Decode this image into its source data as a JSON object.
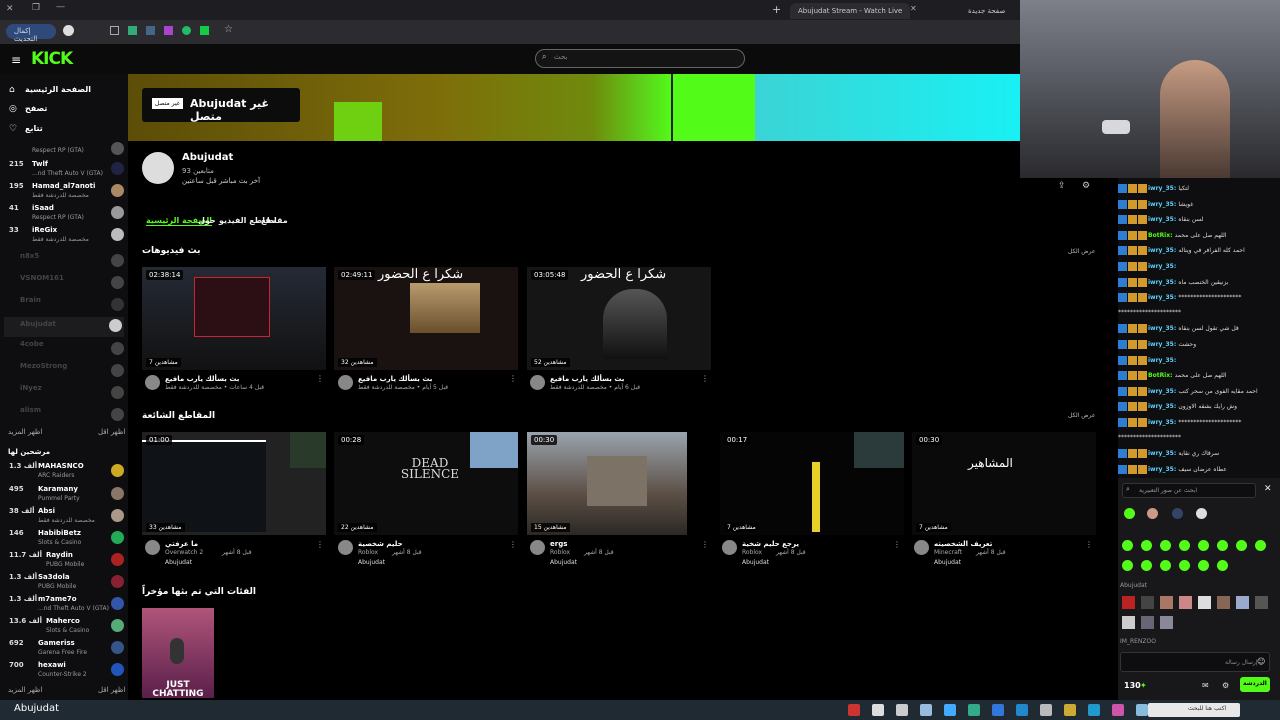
{
  "browser": {
    "tab_left_title": "صفحة جديدة",
    "tab_active_title": "Abujudat Stream - Watch Live",
    "update_button": "إكمال التحديث",
    "new_tab_plus": "+"
  },
  "site": {
    "logo": "KICK",
    "search_placeholder": "بحث"
  },
  "sidebar": {
    "nav": [
      {
        "label": "الصفحة الرئيسية",
        "icon": "home-icon"
      },
      {
        "label": "تصفح",
        "icon": "compass-icon"
      },
      {
        "label": "تتابع",
        "icon": "heart-icon"
      }
    ],
    "following": [
      {
        "count": "",
        "name": "",
        "sub": "Respect RP (GTA)"
      },
      {
        "count": "215",
        "name": "Twlf",
        "sub": "...nd Theft Auto V (GTA)"
      },
      {
        "count": "195",
        "name": "Hamad_al7anoti",
        "sub": "مخصصة للدردشة فقط"
      },
      {
        "count": "41",
        "name": "iSaad",
        "sub": "Respect RP (GTA)"
      },
      {
        "count": "33",
        "name": "iReGix",
        "sub": "مخصصة للدردشة فقط"
      },
      {
        "count": "",
        "name": "n8x5",
        "sub": ""
      },
      {
        "count": "",
        "name": "VSNOM161",
        "sub": ""
      },
      {
        "count": "",
        "name": "Brain",
        "sub": ""
      },
      {
        "count": "",
        "name": "Abujudat",
        "sub": ""
      },
      {
        "count": "",
        "name": "4cobe",
        "sub": ""
      },
      {
        "count": "",
        "name": "MezoStrong",
        "sub": ""
      },
      {
        "count": "",
        "name": "iNyez",
        "sub": ""
      },
      {
        "count": "",
        "name": "alism",
        "sub": ""
      }
    ],
    "show_more_1": "اظهر المزيد",
    "show_less_1": "اظهر اقل",
    "recommended_header": "مرشحين لها",
    "recommended": [
      {
        "count": "1.3 ألف",
        "name": "MAHASNCO",
        "sub": "ARC Raiders"
      },
      {
        "count": "495",
        "name": "Karamany",
        "sub": "Pummel Party"
      },
      {
        "count": "38 ألف",
        "name": "Absi",
        "sub": "مخصصة للدردشة فقط"
      },
      {
        "count": "146",
        "name": "HabibiBetz",
        "sub": "Slots & Casino"
      },
      {
        "count": "11.7 ألف",
        "name": "Raydin",
        "sub": "PUBG Mobile"
      },
      {
        "count": "1.3 ألف",
        "name": "Sa3dola",
        "sub": "PUBG Mobile"
      },
      {
        "count": "1.3 ألف",
        "name": "m7ame7o",
        "sub": "...nd Theft Auto V (GTA)"
      },
      {
        "count": "13.6 ألف",
        "name": "Maherco",
        "sub": "Slots & Casino"
      },
      {
        "count": "692",
        "name": "Gameriss",
        "sub": "Garena Free Fire"
      },
      {
        "count": "700",
        "name": "hexawi",
        "sub": "Counter-Strike 2"
      }
    ],
    "show_more_2": "اظهر المزيد",
    "show_less_2": "اظهر اقل"
  },
  "channel": {
    "offline_title": "Abujudat غير متصل",
    "offline_badge": "غير متصل",
    "name": "Abujudat",
    "followers": "93 متابعين",
    "last_live": "آخر بث مباشر قبل ساعتين",
    "tabs": [
      "الصفحة الرئيسية",
      "حول",
      "مقاطع الفيديو",
      "مقاطع"
    ]
  },
  "videos_section": {
    "title": "بث فيديوهات",
    "show_all": "عرض الكل",
    "items": [
      {
        "duration": "02:38:14",
        "views": "7 مشاهدين",
        "title": "بث بسألك يارب مافيع",
        "sub": "قبل 4 ساعات • مخصصة للدردشة فقط"
      },
      {
        "duration": "02:49:11",
        "views": "32 مشاهدين",
        "title": "بث بسألك يارب مافيع",
        "sub": "قبل 5 أيام • مخصصة للدردشة فقط",
        "overlay": "شكرا ع الحضور"
      },
      {
        "duration": "03:05:48",
        "views": "52 مشاهدين",
        "title": "بث بسألك يارب مافيع",
        "sub": "قبل 6 أيام • مخصصة للدردشة فقط",
        "overlay": "شكرا ع الحضور"
      }
    ]
  },
  "clips_section": {
    "title": "المقاطع الشائعة",
    "show_all": "عرض الكل",
    "items": [
      {
        "duration": "01:00",
        "views": "33 مشاهدين",
        "title": "ما عرفتي",
        "game": "Overwatch 2",
        "age": "قبل 8 أشهر",
        "author": "Abujudat"
      },
      {
        "duration": "00:28",
        "views": "22 مشاهدين",
        "title": "حليم شخصية",
        "game": "Roblox",
        "age": "قبل 8 أشهر",
        "author": "Abujudat",
        "overlay": "DEAD SILENCE"
      },
      {
        "duration": "00:30",
        "views": "15 مشاهدين",
        "title": "ergs",
        "game": "Roblox",
        "age": "قبل 8 أشهر",
        "author": "Abujudat"
      },
      {
        "duration": "00:17",
        "views": "7 مشاهدين",
        "title": "يرجع حليم شخية",
        "game": "Roblox",
        "age": "قبل 8 أشهر",
        "author": "Abujudat"
      },
      {
        "duration": "00:30",
        "views": "7 مشاهدين",
        "title": "تعريف الشخصيته",
        "game": "Minecraft",
        "age": "قبل 8 أشهر",
        "author": "Abujudat",
        "overlay": "المشاهير"
      }
    ]
  },
  "categories_section": {
    "title": "الفئات التي تم بثها مؤخراً",
    "items": [
      {
        "label": "JUST CHATTING"
      }
    ]
  },
  "chat": {
    "messages": [
      {
        "user": "iwry_35:",
        "text": "لتكيا"
      },
      {
        "user": "iwry_35:",
        "text": "غويشا"
      },
      {
        "user": "iwry_35:",
        "text": "لسن بنقاه"
      },
      {
        "user": "BotRix:",
        "text": "اللهم صل على محمد",
        "bot": true
      },
      {
        "user": "iwry_35:",
        "text": "احمد كله الفرافر في ويناله"
      },
      {
        "user": "iwry_35:",
        "text": ""
      },
      {
        "user": "iwry_35:",
        "text": "بزنيقين الخنصب ماه"
      },
      {
        "user": "iwry_35:",
        "text": "*********************"
      },
      {
        "user": "",
        "text": "*********************"
      },
      {
        "user": "iwry_35:",
        "text": "قل شي تقول لسن بنقاه"
      },
      {
        "user": "iwry_35:",
        "text": "وحشت"
      },
      {
        "user": "iwry_35:",
        "text": ""
      },
      {
        "user": "BotRix:",
        "text": "اللهم صل على محمد",
        "bot": true
      },
      {
        "user": "iwry_35:",
        "text": "احمد مقايه الفوى من سحر كتب"
      },
      {
        "user": "iwry_35:",
        "text": "وش رايك بشقه الاوزون"
      },
      {
        "user": "iwry_35:",
        "text": "*********************"
      },
      {
        "user": "",
        "text": "*********************"
      },
      {
        "user": "iwry_35:",
        "text": "سرقاك ري نقاية"
      },
      {
        "user": "iwry_35:",
        "text": "عطاه عرضان سيف"
      }
    ],
    "emote_search_placeholder": "ابحث عن صور التعبيرية",
    "emote_group_1": "Abujudat",
    "emote_group_2": "IM_RENZOO",
    "message_placeholder": "إرسال رسالة",
    "points": "130",
    "chat_button": "الدردشة"
  },
  "taskbar": {
    "start_label": "Abujudat",
    "search_placeholder": "اكتب هنا للبحث"
  },
  "colors": {
    "accent": "#53fc18",
    "bg": "#000000",
    "sidebar": "#0e0e10",
    "chat_user": "#5dd2ff"
  }
}
